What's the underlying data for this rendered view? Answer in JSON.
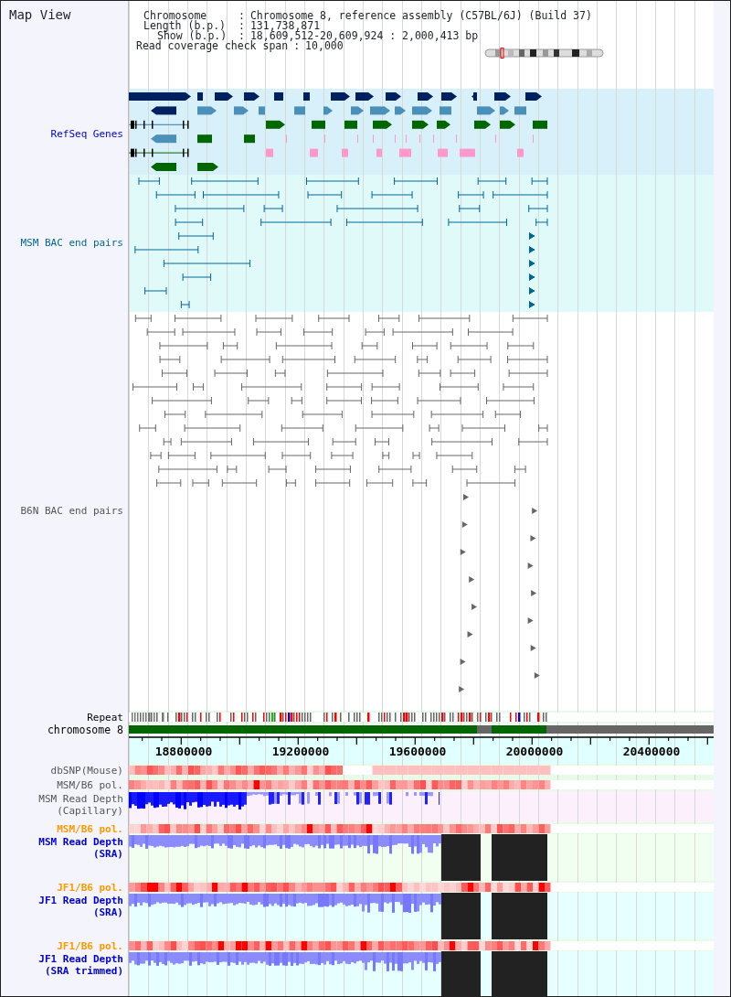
{
  "title": "Map View",
  "info": [
    {
      "label": "Chromosome",
      "sep": ":",
      "value": "Chromosome 8, reference assembly (C57BL/6J) (Build 37)"
    },
    {
      "label": "Length (b.p.)",
      "sep": ":",
      "value": "131,738,871"
    },
    {
      "label": "Show (b.p.)",
      "sep": ":",
      "value": "18,609,512-20,609,924 : 2,000,413 bp"
    },
    {
      "label": "Read coverage check span",
      "sep": ":",
      "value": "10,000"
    }
  ],
  "tracks": [
    {
      "kind": "genes",
      "label": "RefSeq Genes",
      "color": "#0000cc"
    },
    {
      "kind": "bac",
      "label": "MSM BAC end pairs",
      "color": "#006699"
    },
    {
      "kind": "bac",
      "label": "B6N BAC end pairs",
      "color": "#555555"
    },
    {
      "kind": "repeat",
      "label": "Repeat",
      "color": "#000000"
    },
    {
      "kind": "chromosome",
      "label": "chromosome 8",
      "color": "#000000"
    },
    {
      "kind": "axis",
      "ticks": [
        "18800000",
        "19200000",
        "19600000",
        "20000000",
        "20400000"
      ]
    },
    {
      "kind": "snp",
      "label": "dbSNP(Mouse)",
      "color": "#555555"
    },
    {
      "kind": "pol",
      "label": "MSM/B6 pol.",
      "color": "#555555"
    },
    {
      "kind": "capillary",
      "label": "MSM Read Depth (Capillary)",
      "color": "#555555"
    },
    {
      "kind": "pol",
      "label": "MSM/B6 pol.",
      "color": "#ff9900"
    },
    {
      "kind": "sra",
      "label": "MSM Read Depth (SRA)",
      "color": "#0000cc"
    },
    {
      "kind": "pol",
      "label": "JF1/B6 pol.",
      "color": "#ff9900"
    },
    {
      "kind": "sra",
      "label": "JF1 Read Depth (SRA)",
      "color": "#0000cc"
    },
    {
      "kind": "pol",
      "label": "JF1/B6 pol.",
      "color": "#ff9900"
    },
    {
      "kind": "sra",
      "label": "JF1 Read Depth (SRA trimmed)",
      "color": "#0000cc"
    }
  ]
}
